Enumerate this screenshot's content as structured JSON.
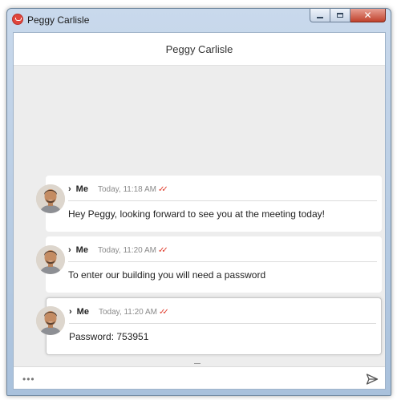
{
  "window": {
    "title": "Peggy Carlisle",
    "app_icon": "app-logo-icon",
    "controls": [
      "minimize-icon",
      "maximize-icon",
      "close-icon"
    ]
  },
  "chat": {
    "header_title": "Peggy Carlisle",
    "messages": [
      {
        "sender": "Me",
        "time": "Today, 11:18 AM",
        "text": "Hey Peggy, looking forward to see you at the meeting today!",
        "status_icon": "read-double-check-icon"
      },
      {
        "sender": "Me",
        "time": "Today, 11:20 AM",
        "text": "To enter our building you will need a password",
        "status_icon": "read-double-check-icon"
      },
      {
        "sender": "Me",
        "time": "Today, 11:20 AM",
        "text": "Password: 753951",
        "status_icon": "read-double-check-icon",
        "selected": true
      }
    ]
  },
  "composer": {
    "more_glyph": "•••",
    "send_icon": "send-icon"
  },
  "colors": {
    "accent_red": "#e03c2c",
    "chat_background": "#ededed",
    "bubble_background": "#ffffff"
  }
}
